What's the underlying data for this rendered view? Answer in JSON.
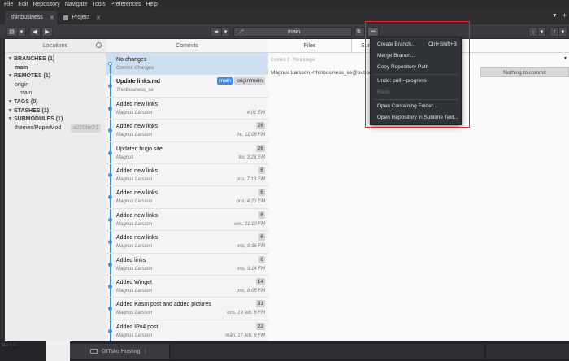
{
  "menubar": [
    "File",
    "Edit",
    "Repository",
    "Navigate",
    "Tools",
    "Preferences",
    "Help"
  ],
  "tabs": [
    {
      "label": "thinbusiness",
      "close": "✕"
    },
    {
      "label": "Project",
      "close": "✕"
    }
  ],
  "tabbar_right": {
    "dropdown": "▼",
    "add": "+"
  },
  "toolbar": {
    "sidebar_toggle": "▤",
    "nav_dropdown": "▾",
    "back": "◀",
    "forward": "▶",
    "stash": "⬌",
    "stash_dropdown": "▾",
    "branch_icon": "⎇",
    "branch_value": "main",
    "search": "🔍",
    "more": "•••",
    "fetch": "↓",
    "fetch_dropdown": "▾",
    "push": "↑",
    "push_dropdown": "▾"
  },
  "sidebar": {
    "header": "Locations",
    "sections": [
      {
        "title": "BRANCHES (1)",
        "caret": "▼",
        "items": [
          "main"
        ]
      },
      {
        "title": "REMOTES (1)",
        "caret": "▼",
        "items": [
          "origin",
          "main"
        ]
      },
      {
        "title": "TAGS (0)",
        "caret": "▼",
        "items": []
      },
      {
        "title": "STASHES (1)",
        "caret": "▼",
        "items": []
      },
      {
        "title": "SUBMODULES (1)",
        "caret": "▼",
        "items": []
      }
    ],
    "submodule": {
      "name": "themes/PaperMod",
      "hash": "a020be21"
    }
  },
  "commits_header": "Commits",
  "commits": [
    {
      "msg": "No changes",
      "who": "Commit Changes",
      "when": "",
      "count": ""
    },
    {
      "msg": "Update links.md",
      "who": "ThinBusiness_se",
      "when": "",
      "count": "",
      "tag_main": "main",
      "tag_remote": "origin/main"
    },
    {
      "msg": "Added new links",
      "who": "Magnus Larsson",
      "when": "4:01 EM",
      "count": ""
    },
    {
      "msg": "Added new links",
      "who": "Magnus Larsson",
      "when": "fre, 11:06 FM",
      "count": "26"
    },
    {
      "msg": "Updated hugo site",
      "who": "Magnus",
      "when": "tor, 3:28 EM",
      "count": "26"
    },
    {
      "msg": "Added new links",
      "who": "Magnus Larsson",
      "when": "ons, 7:13 EM",
      "count": "6"
    },
    {
      "msg": "Added new links",
      "who": "Magnus Larsson",
      "when": "ons, 4:20 EM",
      "count": "6"
    },
    {
      "msg": "Added new links",
      "who": "Magnus Larsson",
      "when": "ons, 11:10 FM",
      "count": "6"
    },
    {
      "msg": "Added new links",
      "who": "Magnus Larsson",
      "when": "ons, 9:36 FM",
      "count": "6"
    },
    {
      "msg": "Added links",
      "who": "Magnus Larsson",
      "when": "ons, 9:14 FM",
      "count": "6"
    },
    {
      "msg": "Added Winget",
      "who": "Magnus Larsson",
      "when": "ons, 8:05 FM",
      "count": "14"
    },
    {
      "msg": "Added Kasm post and added pictures",
      "who": "Magnus Larsson",
      "when": "ons, 19 feb, 8 FM",
      "count": "31"
    },
    {
      "msg": "Added IPv4 post",
      "who": "Magnus Larsson",
      "when": "mån, 17 feb, 8 FM",
      "count": "22"
    }
  ],
  "files": {
    "tabs": [
      "Files",
      "Summary"
    ],
    "commit_message_placeholder": "Commit Message",
    "dropdown": "▾",
    "author": "Magnus Larsson <thinbusiness_se@outlook",
    "nothing_to_commit": "Nothing to commit"
  },
  "menu": {
    "items": [
      {
        "label": "Create Branch...",
        "shortcut": "Ctrl+Shift+B",
        "disabled": false
      },
      {
        "label": "Merge Branch...",
        "shortcut": "",
        "disabled": false
      },
      {
        "label": "Copy Repository Path",
        "shortcut": "",
        "disabled": false
      },
      {
        "label": "Undo: pull --progress",
        "shortcut": "",
        "disabled": false
      },
      {
        "label": "Redo",
        "shortcut": "",
        "disabled": true
      },
      {
        "label": "Open Containing Folder...",
        "shortcut": "",
        "disabled": false
      },
      {
        "label": "Open Repository in Sublime Text...",
        "shortcut": "",
        "disabled": false
      }
    ]
  },
  "taskbar": {
    "left_text": "u-i ~  ~",
    "folder_label": "GITsko Hosting",
    "folder_chevron": "›"
  },
  "colors": {
    "accent": "#3c8fe0",
    "highlight_border": "#e2262a",
    "menu_bg": "#2f3237"
  }
}
